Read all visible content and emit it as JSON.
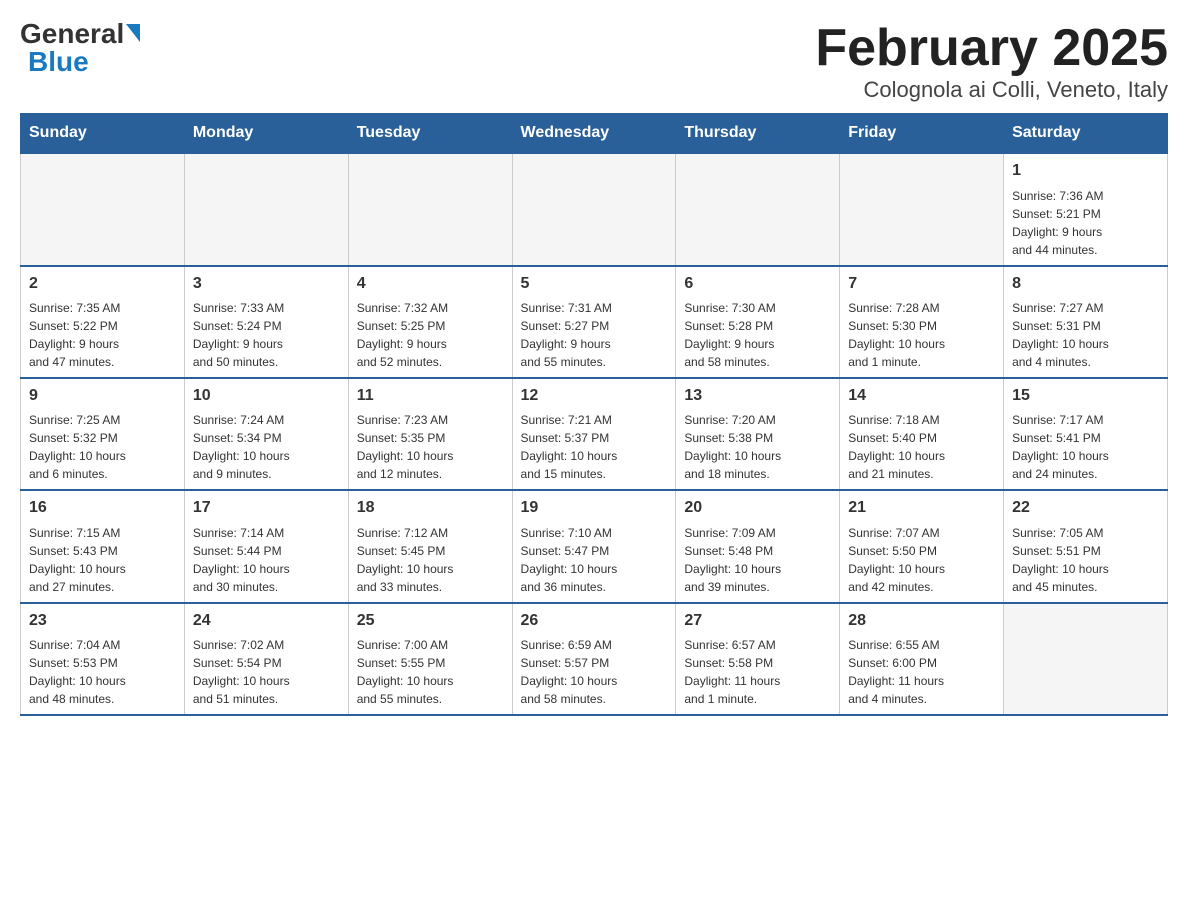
{
  "logo": {
    "general": "General",
    "blue": "Blue",
    "triangle": "▲"
  },
  "title": "February 2025",
  "subtitle": "Colognola ai Colli, Veneto, Italy",
  "weekdays": [
    "Sunday",
    "Monday",
    "Tuesday",
    "Wednesday",
    "Thursday",
    "Friday",
    "Saturday"
  ],
  "weeks": [
    [
      {
        "day": "",
        "info": ""
      },
      {
        "day": "",
        "info": ""
      },
      {
        "day": "",
        "info": ""
      },
      {
        "day": "",
        "info": ""
      },
      {
        "day": "",
        "info": ""
      },
      {
        "day": "",
        "info": ""
      },
      {
        "day": "1",
        "info": "Sunrise: 7:36 AM\nSunset: 5:21 PM\nDaylight: 9 hours\nand 44 minutes."
      }
    ],
    [
      {
        "day": "2",
        "info": "Sunrise: 7:35 AM\nSunset: 5:22 PM\nDaylight: 9 hours\nand 47 minutes."
      },
      {
        "day": "3",
        "info": "Sunrise: 7:33 AM\nSunset: 5:24 PM\nDaylight: 9 hours\nand 50 minutes."
      },
      {
        "day": "4",
        "info": "Sunrise: 7:32 AM\nSunset: 5:25 PM\nDaylight: 9 hours\nand 52 minutes."
      },
      {
        "day": "5",
        "info": "Sunrise: 7:31 AM\nSunset: 5:27 PM\nDaylight: 9 hours\nand 55 minutes."
      },
      {
        "day": "6",
        "info": "Sunrise: 7:30 AM\nSunset: 5:28 PM\nDaylight: 9 hours\nand 58 minutes."
      },
      {
        "day": "7",
        "info": "Sunrise: 7:28 AM\nSunset: 5:30 PM\nDaylight: 10 hours\nand 1 minute."
      },
      {
        "day": "8",
        "info": "Sunrise: 7:27 AM\nSunset: 5:31 PM\nDaylight: 10 hours\nand 4 minutes."
      }
    ],
    [
      {
        "day": "9",
        "info": "Sunrise: 7:25 AM\nSunset: 5:32 PM\nDaylight: 10 hours\nand 6 minutes."
      },
      {
        "day": "10",
        "info": "Sunrise: 7:24 AM\nSunset: 5:34 PM\nDaylight: 10 hours\nand 9 minutes."
      },
      {
        "day": "11",
        "info": "Sunrise: 7:23 AM\nSunset: 5:35 PM\nDaylight: 10 hours\nand 12 minutes."
      },
      {
        "day": "12",
        "info": "Sunrise: 7:21 AM\nSunset: 5:37 PM\nDaylight: 10 hours\nand 15 minutes."
      },
      {
        "day": "13",
        "info": "Sunrise: 7:20 AM\nSunset: 5:38 PM\nDaylight: 10 hours\nand 18 minutes."
      },
      {
        "day": "14",
        "info": "Sunrise: 7:18 AM\nSunset: 5:40 PM\nDaylight: 10 hours\nand 21 minutes."
      },
      {
        "day": "15",
        "info": "Sunrise: 7:17 AM\nSunset: 5:41 PM\nDaylight: 10 hours\nand 24 minutes."
      }
    ],
    [
      {
        "day": "16",
        "info": "Sunrise: 7:15 AM\nSunset: 5:43 PM\nDaylight: 10 hours\nand 27 minutes."
      },
      {
        "day": "17",
        "info": "Sunrise: 7:14 AM\nSunset: 5:44 PM\nDaylight: 10 hours\nand 30 minutes."
      },
      {
        "day": "18",
        "info": "Sunrise: 7:12 AM\nSunset: 5:45 PM\nDaylight: 10 hours\nand 33 minutes."
      },
      {
        "day": "19",
        "info": "Sunrise: 7:10 AM\nSunset: 5:47 PM\nDaylight: 10 hours\nand 36 minutes."
      },
      {
        "day": "20",
        "info": "Sunrise: 7:09 AM\nSunset: 5:48 PM\nDaylight: 10 hours\nand 39 minutes."
      },
      {
        "day": "21",
        "info": "Sunrise: 7:07 AM\nSunset: 5:50 PM\nDaylight: 10 hours\nand 42 minutes."
      },
      {
        "day": "22",
        "info": "Sunrise: 7:05 AM\nSunset: 5:51 PM\nDaylight: 10 hours\nand 45 minutes."
      }
    ],
    [
      {
        "day": "23",
        "info": "Sunrise: 7:04 AM\nSunset: 5:53 PM\nDaylight: 10 hours\nand 48 minutes."
      },
      {
        "day": "24",
        "info": "Sunrise: 7:02 AM\nSunset: 5:54 PM\nDaylight: 10 hours\nand 51 minutes."
      },
      {
        "day": "25",
        "info": "Sunrise: 7:00 AM\nSunset: 5:55 PM\nDaylight: 10 hours\nand 55 minutes."
      },
      {
        "day": "26",
        "info": "Sunrise: 6:59 AM\nSunset: 5:57 PM\nDaylight: 10 hours\nand 58 minutes."
      },
      {
        "day": "27",
        "info": "Sunrise: 6:57 AM\nSunset: 5:58 PM\nDaylight: 11 hours\nand 1 minute."
      },
      {
        "day": "28",
        "info": "Sunrise: 6:55 AM\nSunset: 6:00 PM\nDaylight: 11 hours\nand 4 minutes."
      },
      {
        "day": "",
        "info": ""
      }
    ]
  ]
}
